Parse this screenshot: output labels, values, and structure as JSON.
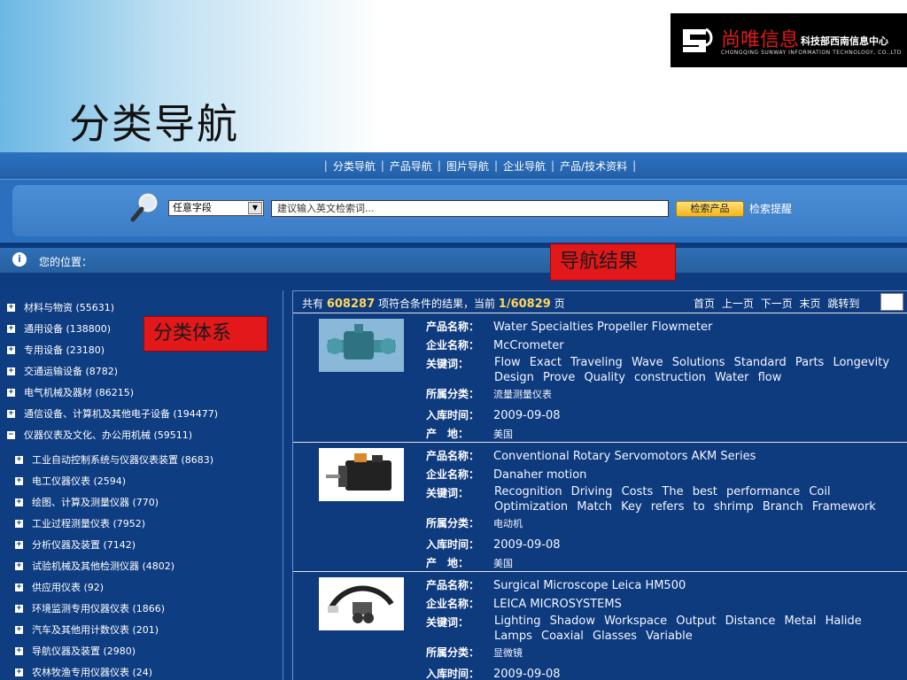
{
  "slide": {
    "title": "分类导航",
    "logo_cn": "尚唯信息",
    "logo_sub": "科技部西南信息中心",
    "logo_en": "CHONGQING SUNWAY INFORMATION TECHNOLOGY, CO.,LTD",
    "callouts": {
      "results": "导航结果",
      "categories": "分类体系"
    }
  },
  "nav": {
    "items": [
      "分类导航",
      "产品导航",
      "图片导航",
      "企业导航",
      "产品/技术资料"
    ]
  },
  "search": {
    "field_select": "任意字段",
    "input_value": "建议输入英文检索词...",
    "button": "检索产品",
    "hint_link": "检索提醒"
  },
  "location": {
    "label": "您的位置："
  },
  "categories": [
    {
      "label": "材料与物资 (55631)",
      "toggle": "+",
      "level": 0
    },
    {
      "label": "通用设备 (138800)",
      "toggle": "+",
      "level": 0
    },
    {
      "label": "专用设备 (23180)",
      "toggle": "+",
      "level": 0
    },
    {
      "label": "交通运输设备 (8782)",
      "toggle": "+",
      "level": 0
    },
    {
      "label": "电气机械及器材 (86215)",
      "toggle": "+",
      "level": 0
    },
    {
      "label": "通信设备、计算机及其他电子设备 (194477)",
      "toggle": "+",
      "level": 0
    },
    {
      "label": "仪器仪表及文化、办公用机械 (59511)",
      "toggle": "−",
      "level": 0
    },
    {
      "label": "工业自动控制系统与仪器仪表装置 (8683)",
      "toggle": "+",
      "level": 1
    },
    {
      "label": "电工仪器仪表 (2594)",
      "toggle": "+",
      "level": 1
    },
    {
      "label": "绘图、计算及测量仪器 (770)",
      "toggle": "+",
      "level": 1
    },
    {
      "label": "工业过程测量仪表 (7952)",
      "toggle": "+",
      "level": 1
    },
    {
      "label": "分析仪器及装置 (7142)",
      "toggle": "+",
      "level": 1
    },
    {
      "label": "试验机械及其他检测仪器 (4802)",
      "toggle": "+",
      "level": 1
    },
    {
      "label": "供应用仪表 (92)",
      "toggle": "+",
      "level": 1
    },
    {
      "label": "环境监测专用仪器仪表 (1866)",
      "toggle": "+",
      "level": 1
    },
    {
      "label": "汽车及其他用计数仪表 (201)",
      "toggle": "+",
      "level": 1
    },
    {
      "label": "导航仪器及装置 (2980)",
      "toggle": "+",
      "level": 1
    },
    {
      "label": "农林牧渔专用仪器仪表 (24)",
      "toggle": "+",
      "level": 1
    }
  ],
  "results": {
    "prefix": "共有",
    "total": "608287",
    "mid": "项符合条件的结果，当前",
    "page": "1/60829",
    "suffix": "页",
    "pager": [
      "首页",
      "上一页",
      "下一页",
      "末页",
      "跳转到"
    ],
    "labels": {
      "name": "产品名称：",
      "company": "企业名称：",
      "keywords": "关键词：",
      "category": "所属分类：",
      "date": "入库时间：",
      "origin": "产　地："
    },
    "items": [
      {
        "thumb_icon": "flowmeter-image",
        "name": "Water Specialties Propeller Flowmeter",
        "company": "McCrometer",
        "keywords_line1": "Flow Exact Traveling Wave Solutions Standard Parts Longevity",
        "keywords_line2": "Design Prove Quality construction Water flow",
        "category": "流量测量仪表",
        "date": "2009-09-08",
        "origin": "美国"
      },
      {
        "thumb_icon": "servomotor-image",
        "name": "Conventional Rotary Servomotors AKM Series",
        "company": "Danaher motion",
        "keywords_line1": "Recognition Driving Costs The best performance Coil",
        "keywords_line2": "Optimization Match Key refers to shrimp Branch Framework",
        "category": "电动机",
        "date": "2009-09-08",
        "origin": "美国"
      },
      {
        "thumb_icon": "microscope-image",
        "name": "Surgical Microscope Leica HM500",
        "company": "LEICA MICROSYSTEMS",
        "keywords_line1": "Lighting Shadow Workspace Output Distance Metal Halide",
        "keywords_line2": "Lamps Coaxial Glasses Variable",
        "category": "显微镜",
        "date": "2009-09-08"
      }
    ]
  }
}
